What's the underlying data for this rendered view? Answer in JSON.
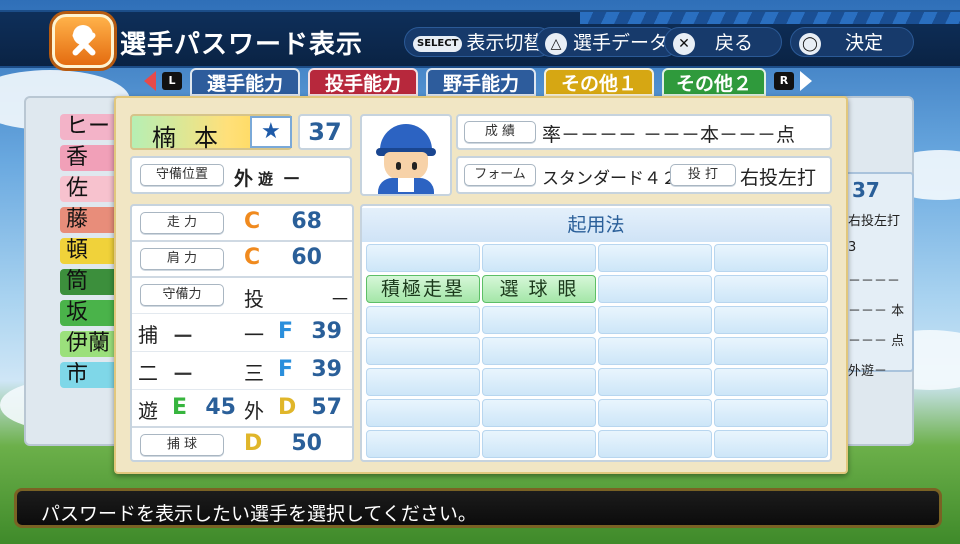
{
  "header": {
    "title": "選手パスワード表示",
    "select_glyph": "SELECT",
    "select_label": "表示切替",
    "triangle_glyph": "△",
    "triangle_label": "選手データ",
    "cross_glyph": "✕",
    "cross_label": "戻る",
    "circle_glyph": "◯",
    "circle_label": "決定"
  },
  "tabs": {
    "left_key": "L",
    "right_key": "R",
    "items": [
      {
        "label": "選手能力",
        "color": "#2d5c9c"
      },
      {
        "label": "投手能力",
        "color": "#b7283c"
      },
      {
        "label": "野手能力",
        "color": "#2d5c9c"
      },
      {
        "label": "その他１",
        "color": "#d6a713"
      },
      {
        "label": "その他２",
        "color": "#2f9a3c"
      }
    ]
  },
  "background_list": {
    "names": [
      "ヒー",
      "香",
      "佐",
      "藤",
      "頓",
      "筒",
      "坂",
      "伊蘭",
      "市"
    ],
    "colors": [
      "#f3b3c8",
      "#f1a0b8",
      "#f7c2ce",
      "#e88d7a",
      "#f0d23a",
      "#3c8f3c",
      "#4ab34a",
      "#9be07c",
      "#7fd7e8"
    ],
    "right_number": "37",
    "right_lines": [
      "右投左打",
      "3",
      "－－－－",
      "－－－ 本",
      "－－－ 点",
      "外遊－"
    ]
  },
  "player": {
    "name": "楠本",
    "number": "37",
    "position_label": "守備位置",
    "position_main": "外",
    "position_sub": "遊",
    "position_extra": "－",
    "record_label": "成 績",
    "record_value": "率－－－－ －－－本－－－点",
    "form_label": "フォーム",
    "form_value": "スタンダード４２",
    "throw_bat_label": "投 打",
    "throw_bat_value": "右投左打"
  },
  "stats": {
    "speed": {
      "label": "走 力",
      "grade": "C",
      "value": "68",
      "grade_color": "#f08a1e"
    },
    "arm": {
      "label": "肩 力",
      "grade": "C",
      "value": "60",
      "grade_color": "#f08a1e"
    },
    "fielding_label": "守備力",
    "pitcher_pos": "投",
    "pitcher_val": "－",
    "rows": [
      {
        "left_pos": "捕",
        "left_grade": "－",
        "left_val": "",
        "right_pos": "一",
        "right_grade": "F",
        "right_val": "39",
        "right_color": "#2a8fdc"
      },
      {
        "left_pos": "二",
        "left_grade": "－",
        "left_val": "",
        "right_pos": "三",
        "right_grade": "F",
        "right_val": "39",
        "right_color": "#2a8fdc"
      },
      {
        "left_pos": "遊",
        "left_grade": "E",
        "left_val": "45",
        "left_color": "#37b53e",
        "right_pos": "外",
        "right_grade": "D",
        "right_val": "57",
        "right_color": "#e0b62a"
      }
    ],
    "catch": {
      "label": "捕 球",
      "grade": "D",
      "value": "50",
      "grade_color": "#e0b62a"
    }
  },
  "skills": {
    "title": "起用法",
    "filled": [
      "積極走塁",
      "選 球 眼"
    ]
  },
  "message": "パスワードを表示したい選手を選択してください。"
}
